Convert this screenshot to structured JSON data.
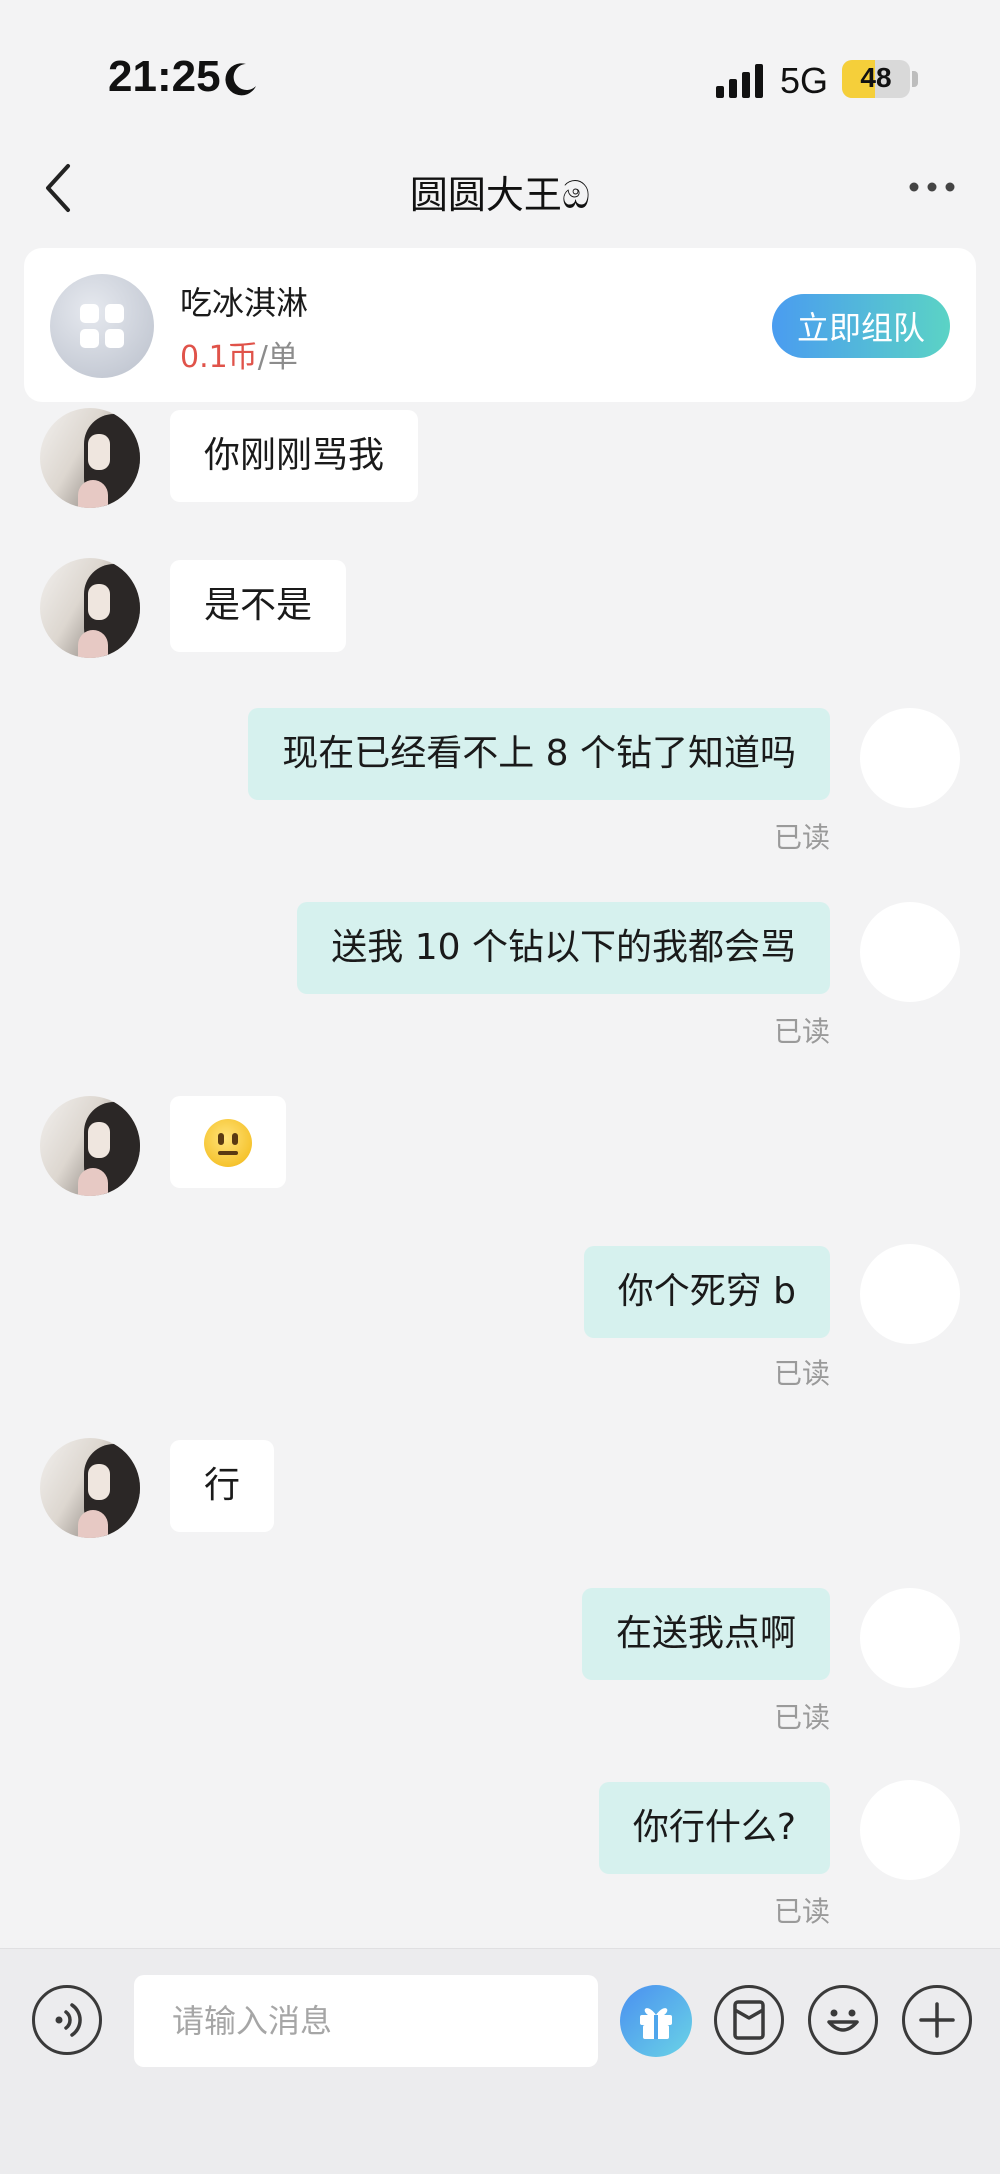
{
  "status_bar": {
    "time": "21:25",
    "network": "5G",
    "battery": "48",
    "battery_level": 0.48
  },
  "header": {
    "title": "圆圆大王ඔ"
  },
  "order_card": {
    "service_name": "吃冰淇淋",
    "price_value": "0.1币",
    "price_unit": "/单",
    "button_label": "立即组队"
  },
  "messages": [
    {
      "side": "left",
      "text": "你刚刚骂我"
    },
    {
      "side": "left",
      "text": "是不是"
    },
    {
      "side": "right",
      "text": "现在已经看不上 8 个钻了知道吗",
      "status": "已读"
    },
    {
      "side": "right",
      "text": "送我 10 个钻以下的我都会骂",
      "status": "已读"
    },
    {
      "side": "left",
      "text": "",
      "emoji": "neutral-face"
    },
    {
      "side": "right",
      "text": "你个死穷 b",
      "status": "已读"
    },
    {
      "side": "left",
      "text": "行"
    },
    {
      "side": "right",
      "text": "在送我点啊",
      "status": "已读"
    },
    {
      "side": "right",
      "text": "你行什么?",
      "status": "已读"
    }
  ],
  "input_bar": {
    "placeholder": "请输入消息"
  },
  "colors": {
    "accent_gradient_start": "#4a9cf0",
    "accent_gradient_end": "#5bd3c5",
    "price_red": "#e0534a",
    "outgoing_bubble": "#d6f1ee"
  }
}
